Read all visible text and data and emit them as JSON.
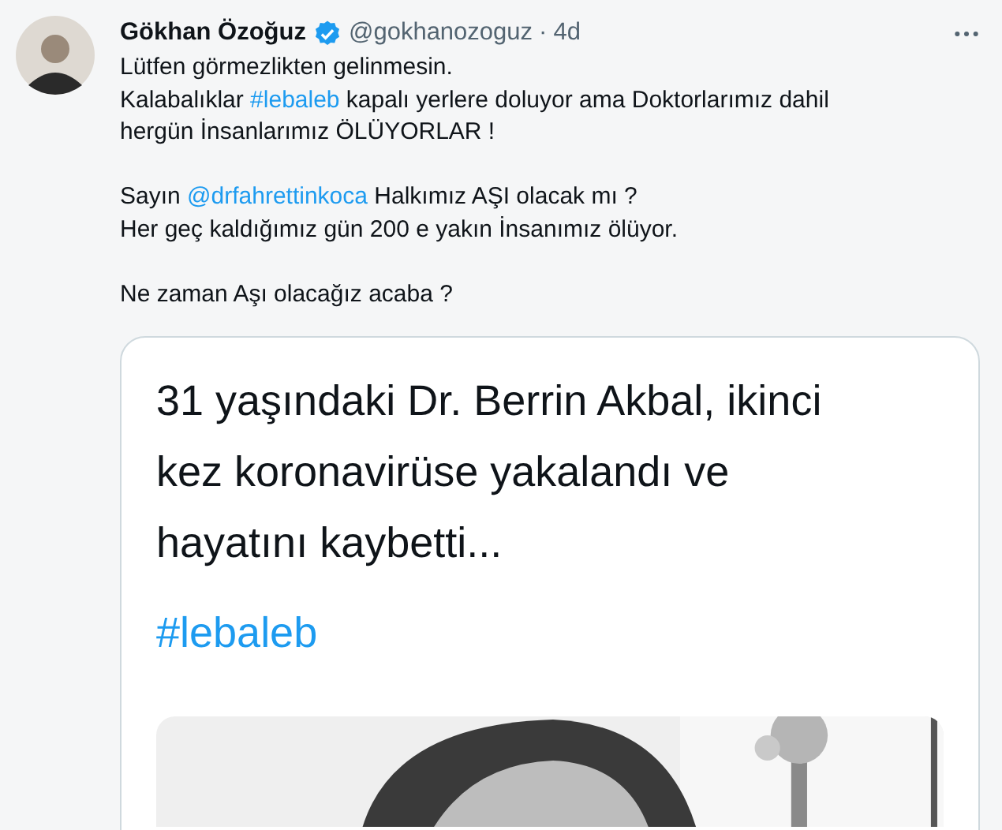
{
  "tweet": {
    "author": {
      "name": "Gökhan Özoğuz",
      "verified": true,
      "handle": "@gokhanozoguz",
      "separator": "·",
      "time": "4d"
    },
    "paragraphs": [
      [
        [
          {
            "kind": "text",
            "text": "Lütfen görmezlikten gelinmesin."
          }
        ],
        [
          {
            "kind": "text",
            "text": "Kalabalıklar "
          },
          {
            "kind": "hashtag",
            "text": "#lebaleb"
          },
          {
            "kind": "text",
            "text": " kapalı yerlere doluyor ama Doktorlarımız dahil hergün İnsanlarımız ÖLÜYORLAR !"
          }
        ]
      ],
      [
        [
          {
            "kind": "text",
            "text": "Sayın "
          },
          {
            "kind": "mention",
            "text": "@drfahrettinkoca"
          },
          {
            "kind": "text",
            "text": " Halkımız AŞI olacak mı ?"
          }
        ],
        [
          {
            "kind": "text",
            "text": "Her geç kaldığımız gün 200 e yakın İnsanımız ölüyor."
          }
        ]
      ],
      [
        [
          {
            "kind": "text",
            "text": "Ne zaman Aşı olacağız acaba ?"
          }
        ]
      ]
    ],
    "card": {
      "headline": "31 yaşındaki Dr. Berrin Akbal, ikinci kez koronavirüse yakalandı ve hayatını kaybetti...",
      "hashtag": "#lebaleb"
    }
  }
}
